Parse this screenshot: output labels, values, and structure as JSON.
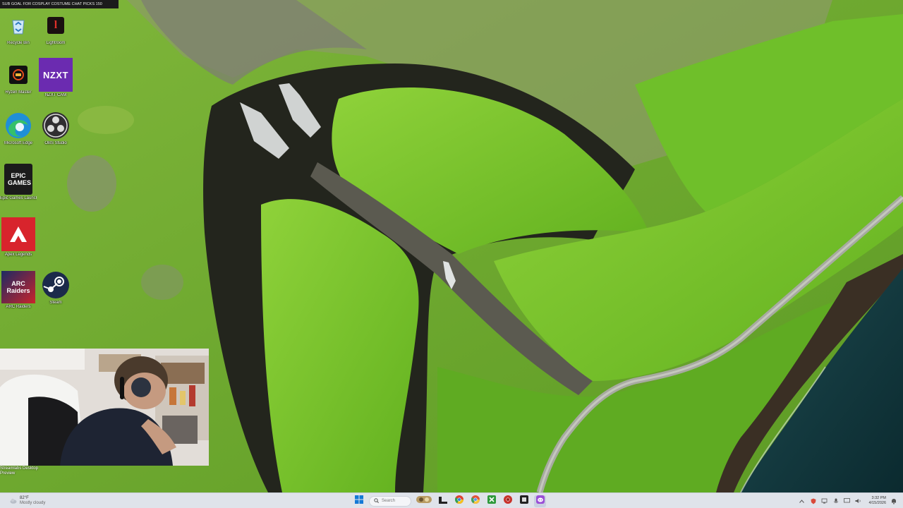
{
  "banner": {
    "text": "SUB GOAL FOR COSPLAY COSTUME CHAT PICKS   150"
  },
  "desktop": {
    "icons": [
      {
        "label": "Recycle Bin",
        "icon": "recycle-bin-icon"
      },
      {
        "label": "Lightroom",
        "icon": "l-app-icon"
      },
      {
        "label": "Ryzen Master",
        "icon": "ryzen-master-icon"
      },
      {
        "label": "NZXT CAM",
        "icon": "nzxt-icon",
        "tile_text": "NZXT"
      },
      {
        "label": "Microsoft Edge",
        "icon": "edge-icon"
      },
      {
        "label": "OBS Studio",
        "icon": "obs-icon"
      },
      {
        "label": "Epic Games Launcher",
        "icon": "epic-games-icon",
        "tile_text": "EPIC GAMES"
      },
      {
        "label": "Apex Legends",
        "icon": "apex-icon"
      },
      {
        "label": "ARC Raiders",
        "icon": "arc-raiders-icon",
        "tile_text": "ARC Raiders"
      },
      {
        "label": "Steam",
        "icon": "steam-icon"
      }
    ]
  },
  "webcam": {
    "caption": "Streamlabs Desktop Preview"
  },
  "taskbar": {
    "weather": {
      "temp": "82°F",
      "condition": "Mostly cloudy"
    },
    "search_placeholder": "Search",
    "apps": [
      "start-icon",
      "search-icon",
      "taskview-icon",
      "file-explorer-icon",
      "chrome-icon",
      "chrome-alt-icon",
      "xbox-icon",
      "chrome-red-icon",
      "obs-taskbar-icon",
      "discord-icon"
    ],
    "clock": {
      "time": "3:32 PM",
      "date": "4/15/2026"
    }
  },
  "colors": {
    "taskbar_bg": "#dfe3ea",
    "grass": "#6fae2c",
    "cliff": "#2a2a22",
    "sea": "#10333a"
  }
}
